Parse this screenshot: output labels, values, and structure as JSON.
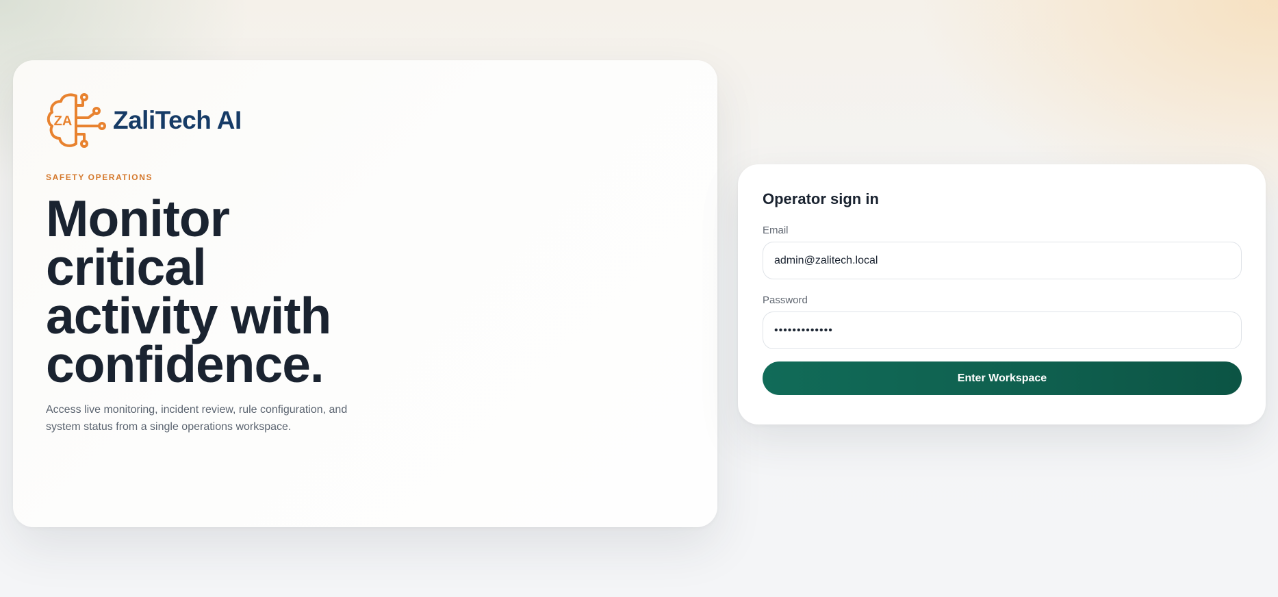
{
  "brand": {
    "logo_icon": "brain-circuit-icon",
    "logo_initials": "ZA",
    "name": "ZaliTech AI",
    "accent_color": "#E8822F",
    "name_color": "#163B66"
  },
  "hero": {
    "eyebrow": "SAFETY OPERATIONS",
    "headline": "Monitor critical activity with confidence.",
    "description": "Access live monitoring, incident review, rule configuration, and system status from a single operations workspace."
  },
  "signin": {
    "title": "Operator sign in",
    "email_label": "Email",
    "email_value": "admin@zalitech.local",
    "password_label": "Password",
    "password_value": "•••••••••••••",
    "submit_label": "Enter Workspace",
    "button_color": "#116B58"
  }
}
